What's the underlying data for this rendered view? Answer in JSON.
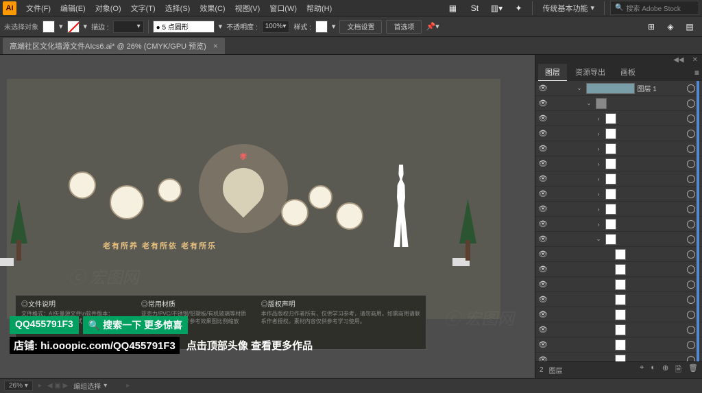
{
  "menubar": {
    "logo": "Ai",
    "items": [
      "文件(F)",
      "编辑(E)",
      "对象(O)",
      "文字(T)",
      "选择(S)",
      "效果(C)",
      "视图(V)",
      "窗口(W)",
      "帮助(H)"
    ],
    "workspace": "传统基本功能",
    "search_placeholder": "搜索 Adobe Stock"
  },
  "control": {
    "selection": "未选择对象",
    "stroke_label": "描边 :",
    "stroke_val": "",
    "point_val": "● 5 点圆形",
    "opacity_label": "不透明度 :",
    "opacity_val": "100%",
    "style_label": "样式 :",
    "doc_setup": "文档设置",
    "prefs": "首选项"
  },
  "tab": {
    "title": "高端社区文化墙源文件AIcs6.ai* @ 26% (CMYK/GPU 预览)"
  },
  "artboard": {
    "slogan": "老有所养 老有所依 老有所乐",
    "red_text": "孝"
  },
  "info": {
    "col1_title": "◎文件说明",
    "col1_body": "文件格式：AI矢量源文件\\n软件版本：Illustrator CS6\\n颜色模式：CMYK印刷模式\\n文件大小：约5-15MB",
    "col2_title": "◎常用材质",
    "col2_body": "亚克力/PVC/不锈钢/铝塑板/有机玻璃等材质均可\\n建议制作尺寸参考效果图比例缩放",
    "col3_title": "◎版权声明",
    "col3_body": "本作品版权归作者所有，仅供学习参考，请勿商用。如需商用请联系作者授权。素材内容仅供参考学习使用。"
  },
  "watermark": "ⓒ 宏图网",
  "promo": {
    "qq": "QQ455791F3",
    "search": "搜索一下 更多惊喜",
    "shop_label": "店铺:",
    "shop_url": "hi.ooopic.com/QQ455791F3",
    "more": "点击顶部头像 查看更多作品"
  },
  "panels": {
    "tabs": [
      "图层",
      "资源导出",
      "画板"
    ],
    "active_tab": 0,
    "main_layer": "图层 1",
    "footer_count": "2",
    "footer_label": "图层"
  },
  "layers": [
    {
      "indent": 0,
      "expand": "⌄",
      "name": "图层 1",
      "thumb": "main"
    },
    {
      "indent": 1,
      "expand": "⌄",
      "name": "",
      "thumb": "grey"
    },
    {
      "indent": 2,
      "expand": "›",
      "name": "",
      "thumb": "small"
    },
    {
      "indent": 2,
      "expand": "›",
      "name": "",
      "thumb": "small"
    },
    {
      "indent": 2,
      "expand": "›",
      "name": "",
      "thumb": "small"
    },
    {
      "indent": 2,
      "expand": "›",
      "name": "",
      "thumb": "small"
    },
    {
      "indent": 2,
      "expand": "›",
      "name": "",
      "thumb": "small"
    },
    {
      "indent": 2,
      "expand": "›",
      "name": "",
      "thumb": "small"
    },
    {
      "indent": 2,
      "expand": "›",
      "name": "",
      "thumb": "small"
    },
    {
      "indent": 2,
      "expand": "›",
      "name": "",
      "thumb": "small"
    },
    {
      "indent": 2,
      "expand": "⌄",
      "name": "",
      "thumb": "small"
    },
    {
      "indent": 3,
      "expand": "",
      "name": "",
      "thumb": "small"
    },
    {
      "indent": 3,
      "expand": "",
      "name": "",
      "thumb": "small"
    },
    {
      "indent": 3,
      "expand": "",
      "name": "",
      "thumb": "small"
    },
    {
      "indent": 3,
      "expand": "",
      "name": "",
      "thumb": "small"
    },
    {
      "indent": 3,
      "expand": "",
      "name": "",
      "thumb": "small"
    },
    {
      "indent": 3,
      "expand": "",
      "name": "",
      "thumb": "small"
    },
    {
      "indent": 3,
      "expand": "",
      "name": "",
      "thumb": "small"
    },
    {
      "indent": 3,
      "expand": "",
      "name": "",
      "thumb": "small"
    },
    {
      "indent": 3,
      "expand": "",
      "name": "",
      "thumb": "small"
    }
  ],
  "status": {
    "zoom": "26%",
    "mode": "编组选择"
  }
}
